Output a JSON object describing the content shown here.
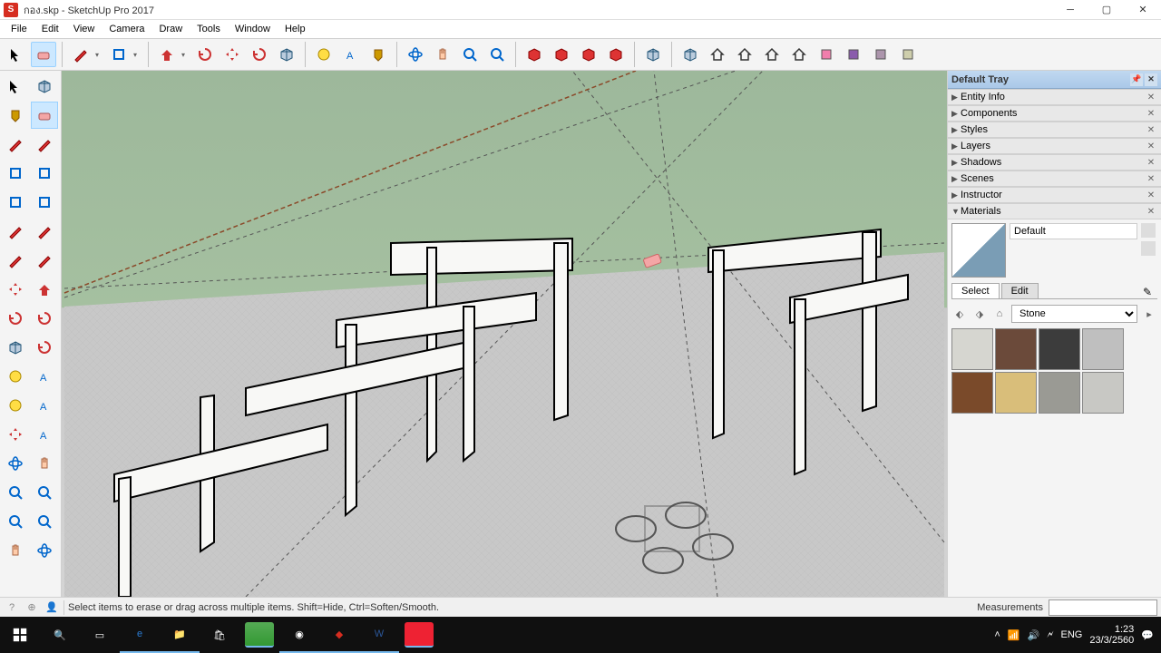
{
  "window": {
    "filename": "กอง.skp",
    "app": "SketchUp Pro 2017"
  },
  "menus": [
    "File",
    "Edit",
    "View",
    "Camera",
    "Draw",
    "Tools",
    "Window",
    "Help"
  ],
  "top_tool_names": [
    "select",
    "eraser",
    "line",
    "shapes",
    "pushpull",
    "offset",
    "move",
    "rotate",
    "scale",
    "followme",
    "tape",
    "text",
    "paint",
    "3dwarehouse-send",
    "3dwarehouse-get",
    "extension-warehouse",
    "orbit",
    "pan",
    "zoom",
    "zoom-extents",
    "add-location",
    "toggle-terrain",
    "preview-ge",
    "photo-match",
    "iso",
    "top",
    "front",
    "right",
    "back",
    "left"
  ],
  "left_tool_names": [
    "select",
    "make-component",
    "paint",
    "eraser",
    "line",
    "freehand",
    "rectangle",
    "rotated-rect",
    "circle",
    "polygon",
    "arc",
    "2pt-arc",
    "3pt-arc",
    "pie",
    "move",
    "pushpull",
    "rotate",
    "followme",
    "scale",
    "offset",
    "tape",
    "dimension",
    "protractor",
    "text",
    "axes",
    "3d-text",
    "orbit",
    "pan",
    "zoom",
    "zoom-window",
    "zoom-extents",
    "previous",
    "position-camera",
    "look-around"
  ],
  "tray": {
    "title": "Default Tray",
    "panels": [
      "Entity Info",
      "Components",
      "Styles",
      "Layers",
      "Shadows",
      "Scenes",
      "Instructor",
      "Materials"
    ],
    "materials": {
      "current_name": "Default",
      "tabs": [
        "Select",
        "Edit"
      ],
      "library": "Stone",
      "swatch_colors": [
        "#d6d6d0",
        "#6b4a3a",
        "#3c3c3c",
        "#bfbfbf",
        "#7a4a2a",
        "#d9be7a",
        "#9a9a94",
        "#c8c8c4"
      ]
    }
  },
  "status": {
    "help": "Select items to erase or drag across multiple items. Shift=Hide, Ctrl=Soften/Smooth.",
    "measure_label": "Measurements"
  },
  "taskbar": {
    "lang": "ENG",
    "time": "1:23",
    "date": "23/3/2560"
  }
}
